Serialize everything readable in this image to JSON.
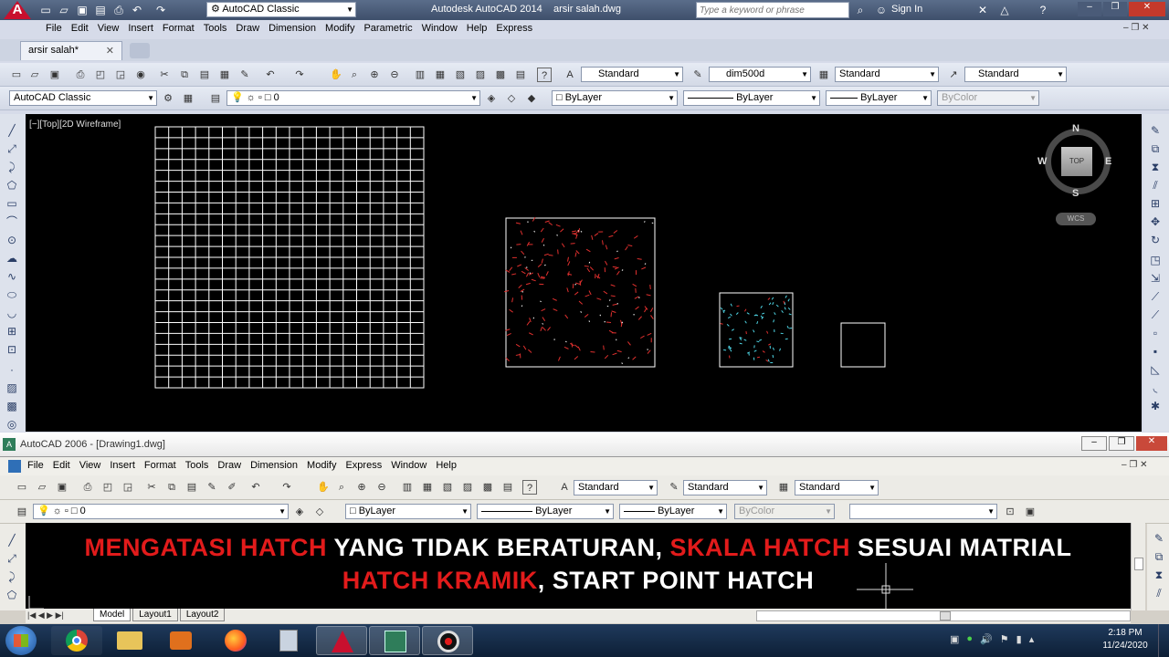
{
  "acad2014": {
    "workspace": "AutoCAD Classic",
    "app_title": "Autodesk AutoCAD 2014",
    "file_title": "arsir salah.dwg",
    "search_placeholder": "Type a keyword or phrase",
    "sign_in": "Sign In",
    "menu": [
      "File",
      "Edit",
      "View",
      "Insert",
      "Format",
      "Tools",
      "Draw",
      "Dimension",
      "Modify",
      "Parametric",
      "Window",
      "Help",
      "Express"
    ],
    "doc_tab": "arsir salah*",
    "styles": {
      "text": "Standard",
      "dim": "dim500d",
      "table": "Standard",
      "mleader": "Standard"
    },
    "workspace2": "AutoCAD Classic",
    "layer": "0",
    "color": "ByLayer",
    "linetype": "ByLayer",
    "lineweight": "ByLayer",
    "plotstyle": "ByColor",
    "viewport_label": "[−][Top][2D Wireframe]",
    "viewcube": {
      "n": "N",
      "s": "S",
      "e": "E",
      "w": "W",
      "top": "TOP",
      "wcs": "WCS"
    }
  },
  "acad2006": {
    "title": "AutoCAD 2006 - [Drawing1.dwg]",
    "menu": [
      "File",
      "Edit",
      "View",
      "Insert",
      "Format",
      "Tools",
      "Draw",
      "Dimension",
      "Modify",
      "Express",
      "Window",
      "Help"
    ],
    "styles": {
      "text": "Standard",
      "dim": "Standard",
      "table": "Standard"
    },
    "layer": "0",
    "color": "ByLayer",
    "linetype": "ByLayer",
    "lineweight": "ByLayer",
    "plotstyle": "ByColor",
    "caption_line1": {
      "red1": "MENGATASI HATCH",
      "white1": " YANG TIDAK BERATURAN, ",
      "red2": "SKALA HATCH",
      "white2": " SESUAI MATRIAL"
    },
    "caption_line2": {
      "red": "HATCH KRAMIK",
      "white": ", START POINT HATCH"
    },
    "layout_tabs": [
      "Model",
      "Layout1",
      "Layout2"
    ]
  },
  "taskbar": {
    "time": "2:18 PM",
    "date": "11/24/2020"
  },
  "colors": {
    "accent_red": "#e21b1b",
    "hatch_red": "#e0302e",
    "hatch_cyan": "#4fd6e6"
  }
}
